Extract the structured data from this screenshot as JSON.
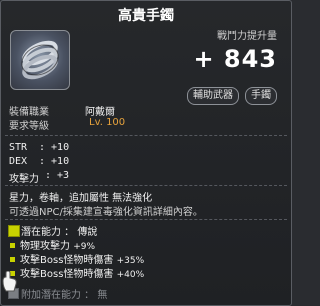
{
  "item": {
    "title": "高貴手鐲",
    "icon": "bracelet-icon"
  },
  "power": {
    "label": "戰鬥力提升量",
    "value": "+ 843",
    "tags": [
      "輔助武器",
      "手鐲"
    ]
  },
  "requirements": {
    "job_label": "裝備職業",
    "job_value": "阿戴爾",
    "level_label": "要求等級",
    "level_value": "Lv. 100"
  },
  "stats": [
    {
      "name": "STR",
      "value": ": +10"
    },
    {
      "name": "DEX",
      "value": ": +10"
    },
    {
      "name": "攻擊力",
      "value": ": +3"
    }
  ],
  "description": {
    "line1": "星力，卷軸，追加屬性 無法強化",
    "line2": "可透過NPC/採集建宣毒強化資訊詳細內容。"
  },
  "potential": {
    "label": "潛在能力 ： 傳說",
    "lines": [
      {
        "text": "物理攻擊力",
        "value": "+9%"
      },
      {
        "text": "攻擊Boss怪物時傷害",
        "value": "+35%"
      },
      {
        "text": "攻擊Boss怪物時傷害",
        "value": "+40%"
      }
    ]
  },
  "additional_potential": {
    "label": "附加潛在能力 ： 無"
  },
  "colors": {
    "accent_orange": "#e6a23c",
    "potential_green": "#c8d200"
  }
}
